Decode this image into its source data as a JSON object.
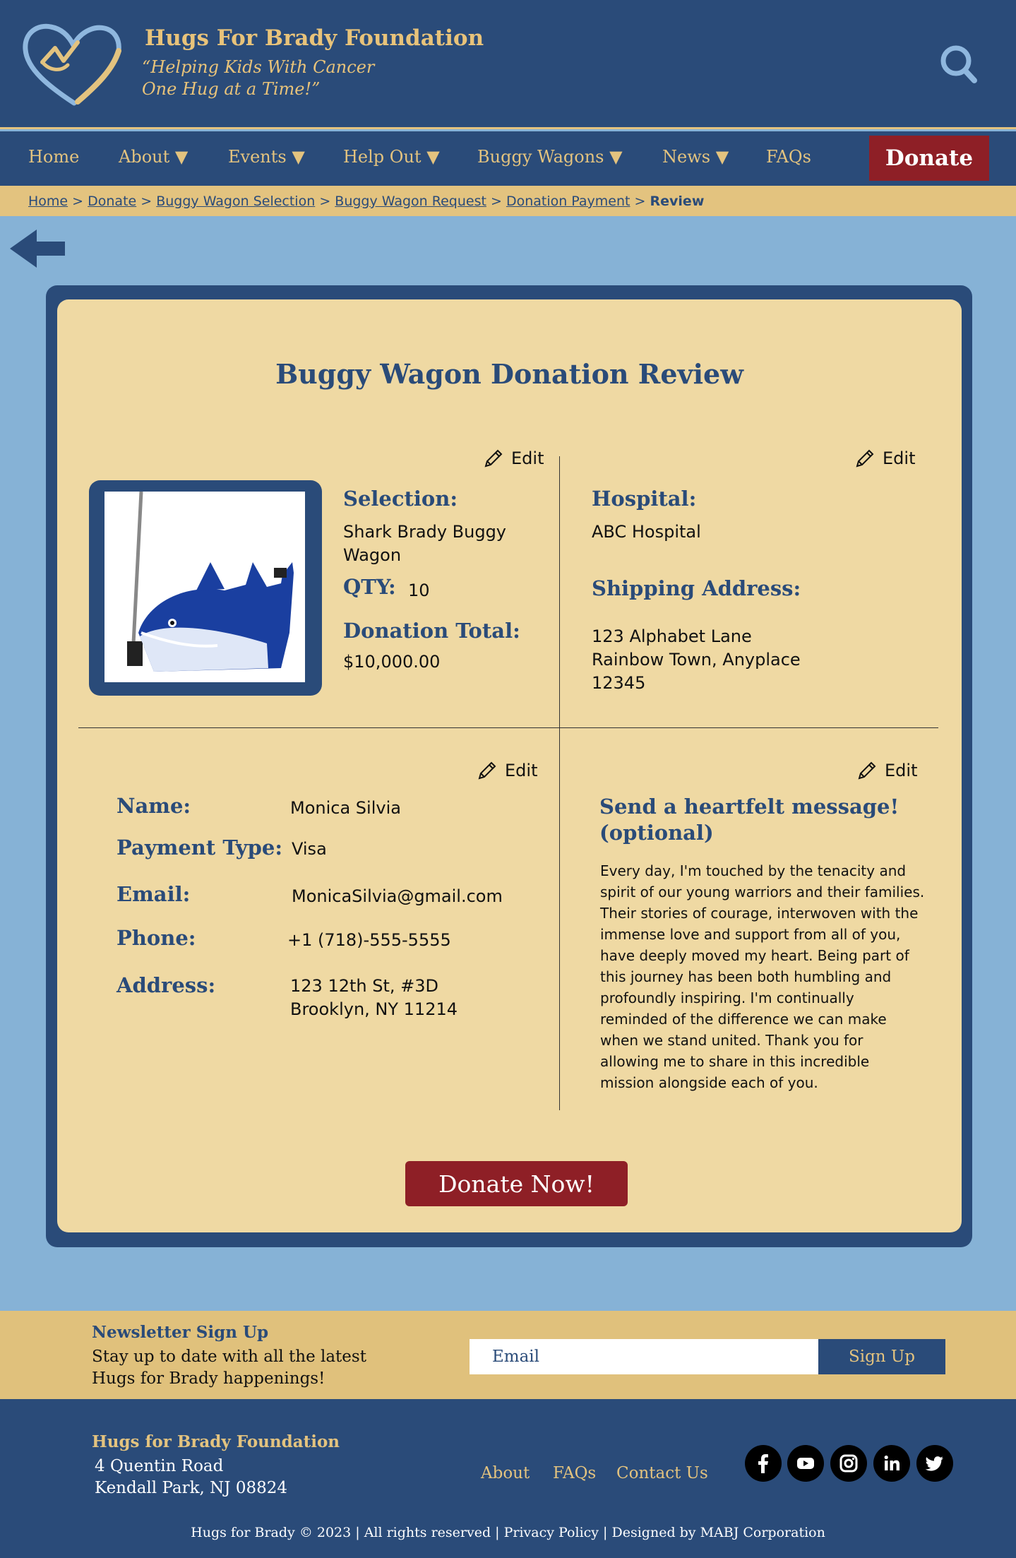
{
  "header": {
    "title": "Hugs For Brady Foundation",
    "tagline_1": "“Helping Kids With Cancer",
    "tagline_2": "One Hug at a Time!”"
  },
  "nav": {
    "items": [
      {
        "label": "Home"
      },
      {
        "label": "About ▼"
      },
      {
        "label": "Events ▼"
      },
      {
        "label": "Help Out ▼"
      },
      {
        "label": "Buggy Wagons ▼"
      },
      {
        "label": "News ▼"
      },
      {
        "label": "FAQs"
      }
    ],
    "donate_label": "Donate"
  },
  "breadcrumb": {
    "items": [
      "Home",
      "Donate",
      "Buggy Wagon Selection",
      "Buggy Wagon Request",
      "Donation Payment"
    ],
    "current": "Review",
    "separator": ">"
  },
  "review": {
    "title": "Buggy Wagon Donation Review",
    "edit_label": "Edit",
    "selection_label": "Selection:",
    "selection_value": "Shark Brady Buggy Wagon",
    "qty_label": "QTY:",
    "qty_value": "10",
    "total_label": "Donation Total:",
    "total_value": "$10,000.00",
    "hospital_label": "Hospital:",
    "hospital_value": "ABC Hospital",
    "shipping_label": "Shipping Address:",
    "shipping_line1": "123 Alphabet Lane",
    "shipping_line2": "Rainbow Town, Anyplace",
    "shipping_line3": "12345",
    "name_label": "Name:",
    "name_value": "Monica Silvia",
    "payment_label": "Payment Type:",
    "payment_value": "Visa",
    "email_label": "Email:",
    "email_value": "MonicaSilvia@gmail.com",
    "phone_label": "Phone:",
    "phone_value": "+1 (718)-555-5555",
    "address_label": "Address:",
    "address_line1": "123 12th St, #3D",
    "address_line2": "Brooklyn, NY 11214",
    "message_label": "Send a heartfelt message! (optional)",
    "message_text": "Every day, I'm touched by the tenacity and spirit of our young warriors and their families. Their stories of courage, interwoven with the immense love and support from all of you, have deeply moved my heart. Being part of this journey has been both humbling and profoundly inspiring. I'm continually reminded of the difference we can make when we stand united. Thank you for allowing me to share in this incredible mission alongside each of you.",
    "donate_now_label": "Donate Now!"
  },
  "newsletter": {
    "title": "Newsletter Sign Up",
    "text_1": "Stay up to date with all the latest",
    "text_2": "Hugs for Brady happenings!",
    "email_placeholder": "Email",
    "signup_label": "Sign Up"
  },
  "footer": {
    "name": "Hugs for Brady Foundation",
    "address_1": "4 Quentin Road",
    "address_2": "Kendall Park, NJ 08824",
    "links": [
      "About",
      "FAQs",
      "Contact Us"
    ],
    "social": [
      "facebook-icon",
      "youtube-icon",
      "instagram-icon",
      "linkedin-icon",
      "twitter-icon"
    ],
    "copyright": "Hugs for Brady © 2023 | All rights reserved | Privacy Policy | Designed by MABJ Corporation"
  },
  "colors": {
    "navy": "#2a4b79",
    "gold": "#e3c37f",
    "cream": "#efd9a3",
    "sky": "#86b2d6",
    "crimson": "#8e1f26"
  }
}
